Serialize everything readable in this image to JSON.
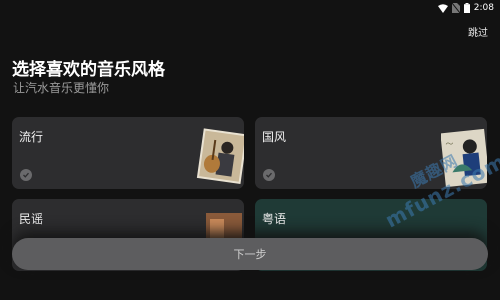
{
  "status_bar": {
    "time": "2:08"
  },
  "header": {
    "skip_label": "跳过",
    "title": "选择喜欢的音乐风格",
    "subtitle": "让汽水音乐更懂你"
  },
  "genres": [
    {
      "label": "流行"
    },
    {
      "label": "国风"
    },
    {
      "label": "民谣"
    },
    {
      "label": "粤语"
    }
  ],
  "footer": {
    "next_label": "下一步"
  },
  "watermark": {
    "text": "mfunz.com",
    "brand": "魔趣网"
  },
  "colors": {
    "background": "#121212",
    "card": "#2d2d2f",
    "card_teal": "#1f3a36",
    "button": "#5d5d5f",
    "watermark": "#3c7ab0"
  }
}
